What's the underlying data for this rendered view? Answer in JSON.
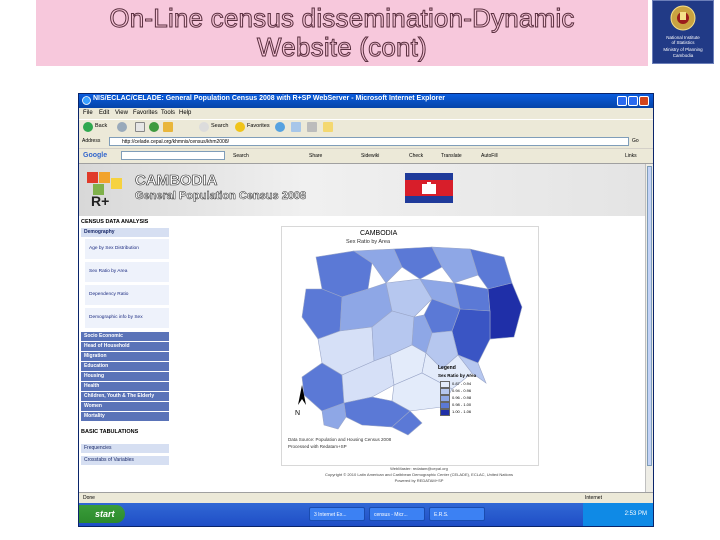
{
  "slide": {
    "title_line1": "On-Line census dissemination-Dynamic",
    "title_line2": "Website (cont)",
    "logo_text_1": "National Institute",
    "logo_text_2": "of Statistics",
    "logo_text_3": "Ministry of Planning",
    "logo_text_4": "Cambodia"
  },
  "browser": {
    "window_title": "NIS/ECLAC/CELADE: General Population Census 2008 with R+SP WebServer - Microsoft Internet Explorer",
    "menu": [
      "File",
      "Edit",
      "View",
      "Favorites",
      "Tools",
      "Help"
    ],
    "toolbar": {
      "back": "Back",
      "search": "Search",
      "favorites": "Favorites"
    },
    "address_label": "Address",
    "address_value": "http://celade.cepal.org/khmnis/census/khm2008/",
    "go_label": "Go",
    "links_label": "Links",
    "google_label": "Google",
    "google_buttons": [
      "Search",
      "Share",
      "Sidewiki",
      "Check",
      "Translate",
      "AutoFill"
    ],
    "status_left": "Done",
    "status_right": "Internet"
  },
  "page": {
    "banner_title": "CAMBODIA",
    "banner_subtitle": "General Population Census 2008",
    "logo_label": "R+",
    "sidebar": {
      "section_census": "CENSUS DATA ANALYSIS",
      "demography": "Demography",
      "demography_subitems": [
        "Age by Sex Distribution",
        "Sex Ratio by Area",
        "Dependency Ratio",
        "Demographic info by Sex"
      ],
      "topics": [
        "Socio Economic",
        "Head of Household",
        "Migration",
        "Education",
        "Housing",
        "Health",
        "Children, Youth & The Elderly",
        "Women",
        "Mortality"
      ],
      "section_basic": "BASIC TABULATIONS",
      "basic_items": [
        "Frequencies",
        "Crosstabs of Variables"
      ]
    },
    "map": {
      "title": "CAMBODIA",
      "subtitle": "Sex Ratio by Area",
      "legend_title": "Legend",
      "legend_subtitle": "Sex Ratio by Area",
      "legend_entries": [
        {
          "range": "0.87 - 0.94",
          "color": "#e3ebfa"
        },
        {
          "range": "0.94 - 0.96",
          "color": "#b6c7ef"
        },
        {
          "range": "0.96 - 0.98",
          "color": "#8ea7e6"
        },
        {
          "range": "0.98 - 1.00",
          "color": "#5b79d6"
        },
        {
          "range": "1.00 - 1.06",
          "color": "#1f2fa8"
        }
      ],
      "north_label": "N",
      "source_line1": "Data Source: Population and Housing Census 2008",
      "source_line2": "Processed with Redatam+SP"
    },
    "footer": {
      "line1": "WebMaster: redatam@cepal.org",
      "line2": "Copyright © 2010 Latin American and Caribbean Demographic Center (CELADE), ECLAC, United Nations",
      "line3": "Powered by REDATAM+SP"
    }
  },
  "taskbar": {
    "start": "start",
    "tasks": [
      "3 Internet Ex...",
      "census - Micr...",
      "E.R.S."
    ],
    "clock": "2:53 PM"
  },
  "colors": {
    "slide_band": "#f7c8dc",
    "logo_bg": "#213a86",
    "map_dark": "#1f2fa8",
    "map_light": "#e3ebfa",
    "xp_title": "#0a5cde"
  }
}
